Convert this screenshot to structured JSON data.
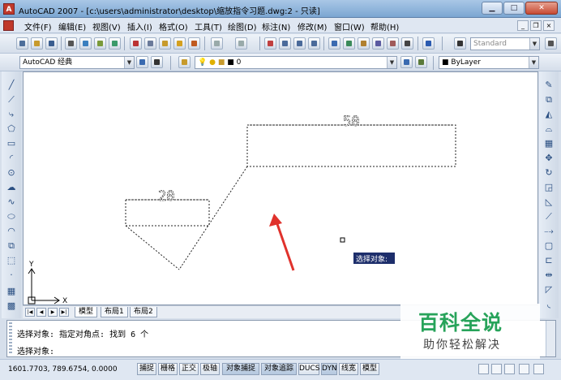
{
  "window": {
    "title": "AutoCAD 2007 - [c:\\users\\administrator\\desktop\\缩放指令习题.dwg:2 - 只读]",
    "app_logo": "A",
    "min_label": "▁",
    "max_label": "□",
    "close_label": "✕"
  },
  "menu": {
    "items": [
      "文件(F)",
      "编辑(E)",
      "视图(V)",
      "插入(I)",
      "格式(O)",
      "工具(T)",
      "绘图(D)",
      "标注(N)",
      "修改(M)",
      "窗口(W)",
      "帮助(H)"
    ],
    "mdi_min": "_",
    "mdi_restore": "❐",
    "mdi_close": "×"
  },
  "toolbar": {
    "text_style": "Standard",
    "workspace": "AutoCAD 经典",
    "layer": "0",
    "color": "ByLayer"
  },
  "drawing": {
    "dim_top": "50",
    "dim_left": "20",
    "tooltip": "选择对象:",
    "ucs_x": "X",
    "ucs_y": "Y"
  },
  "tabs": {
    "nav": [
      "|◀",
      "◀",
      "▶",
      "▶|"
    ],
    "items": [
      "模型",
      "布局1",
      "布局2"
    ],
    "active": "模型"
  },
  "command": {
    "line1": "选择对象: 指定对角点: 找到 6 个",
    "line2": "选择对象:"
  },
  "status": {
    "coords": "1601.7703, 789.6754, 0.0000",
    "buttons": [
      {
        "label": "捕捉",
        "on": false
      },
      {
        "label": "栅格",
        "on": false
      },
      {
        "label": "正交",
        "on": false
      },
      {
        "label": "极轴",
        "on": false
      },
      {
        "label": "对象捕捉",
        "on": true
      },
      {
        "label": "对象追踪",
        "on": true
      },
      {
        "label": "DUCS",
        "on": false
      },
      {
        "label": "DYN",
        "on": true
      },
      {
        "label": "线宽",
        "on": false
      },
      {
        "label": "模型",
        "on": false
      }
    ]
  },
  "watermark": {
    "title": "百科全说",
    "subtitle": "助你轻松解决"
  },
  "colors": {
    "accent_green": "#27a35a",
    "arrow_red": "#e0322c",
    "tooltip_bg": "#1d2e6b"
  }
}
